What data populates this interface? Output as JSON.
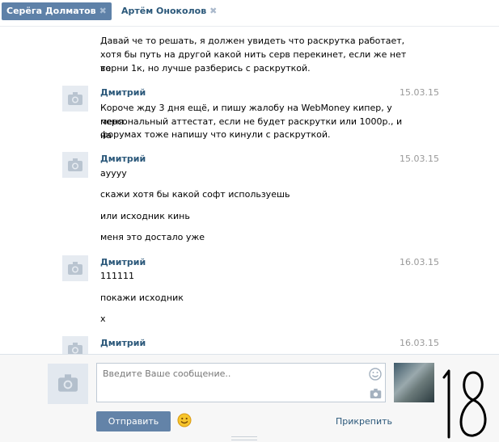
{
  "tabs": [
    {
      "label": "Серёга Долматов",
      "active": true
    },
    {
      "label": "Артём Оноколов",
      "active": false
    }
  ],
  "messages": {
    "first_lines": [
      "Давай че то решать, я должен увидеть что раскрутка работает,",
      "хотя бы путь на другой какой нить серв перекинет, если же нет то",
      "верни 1к, но лучше разберись с раскруткой."
    ],
    "groups": [
      {
        "author": "Дмитрий",
        "date": "15.03.15",
        "lines": [
          "Короче жду 3 дня ещё, и пишу жалобу на WebMoney кипер, у меня",
          "персональный аттестат, если не будет раскрутки или 1000р., и на",
          "форумах тоже напишу что кинули с раскруткой."
        ]
      },
      {
        "author": "Дмитрий",
        "date": "15.03.15",
        "lines": [
          "ауууу",
          "скажи хотя бы какой софт используешь",
          "или исходник кинь",
          "меня это достало уже"
        ]
      },
      {
        "author": "Дмитрий",
        "date": "16.03.15",
        "lines": [
          "111111",
          "покажи исходник",
          "х"
        ]
      },
      {
        "author": "Дмитрий",
        "date": "16.03.15",
        "lines": []
      }
    ]
  },
  "composer": {
    "placeholder": "Введите Ваше сообщение..",
    "send_label": "Отправить",
    "attach_label": "Прикрепить"
  },
  "annotation": {
    "text": "18",
    "style": "handwritten"
  },
  "colors": {
    "accent": "#5e81a8",
    "link": "#2b587a",
    "date": "#999999",
    "button": "#6383a8"
  }
}
